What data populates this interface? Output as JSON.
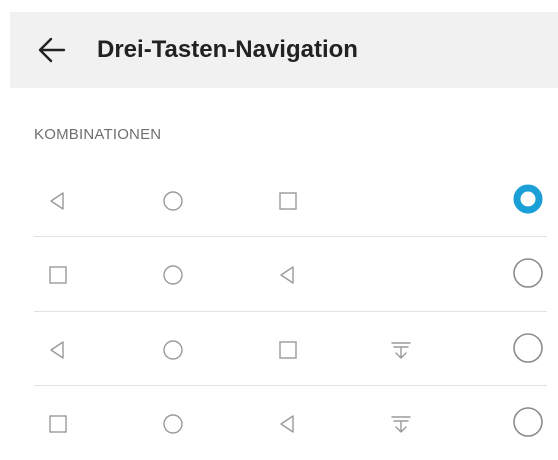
{
  "header": {
    "title": "Drei-Tasten-Navigation",
    "back_icon": "arrow-left-icon"
  },
  "section": {
    "label": "KOMBINATIONEN"
  },
  "colors": {
    "accent": "#1a9fd6",
    "icon": "#9a9a9a",
    "header_bg": "#f1f1f1"
  },
  "combinations": [
    {
      "keys": [
        "back-icon",
        "home-icon",
        "recents-icon"
      ],
      "selected": true
    },
    {
      "keys": [
        "recents-icon",
        "home-icon",
        "back-icon"
      ],
      "selected": false
    },
    {
      "keys": [
        "back-icon",
        "home-icon",
        "recents-icon",
        "notification-pull-icon"
      ],
      "selected": false
    },
    {
      "keys": [
        "recents-icon",
        "home-icon",
        "back-icon",
        "notification-pull-icon"
      ],
      "selected": false
    }
  ]
}
